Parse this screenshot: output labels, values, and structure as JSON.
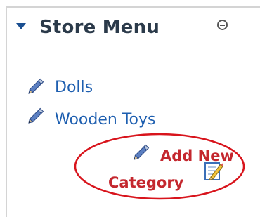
{
  "panel": {
    "title": "Store Menu",
    "collapse_icon": "circle-minus-icon",
    "expand_icon": "triangle-down-icon"
  },
  "menu": {
    "items": [
      {
        "label": "Dolls",
        "icon": "pencil-icon"
      },
      {
        "label": "Wooden Toys",
        "icon": "pencil-icon"
      }
    ],
    "add": {
      "line1": "Add New",
      "line2": "Category",
      "icon": "pencil-icon",
      "edit_icon": "notepad-pencil-icon"
    }
  },
  "colors": {
    "link": "#1e5fb0",
    "add": "#c4272e",
    "title": "#2b3a4a",
    "highlight": "#d8141c",
    "border": "#d4d4d4"
  }
}
